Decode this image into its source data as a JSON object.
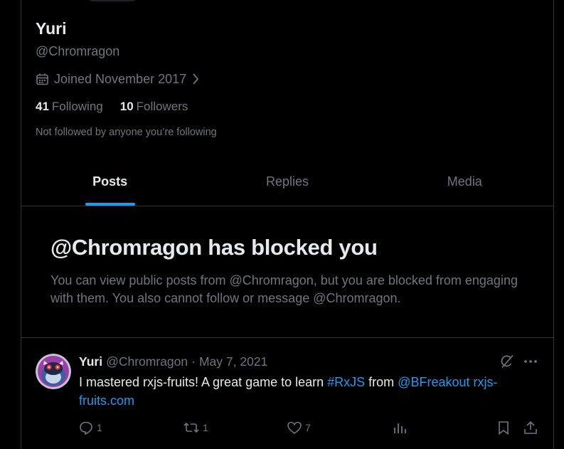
{
  "profile": {
    "name": "Yuri",
    "handle": "@Chromragon",
    "joined": "Joined November 2017",
    "following_count": "41",
    "following_label": "Following",
    "followers_count": "10",
    "followers_label": "Followers",
    "not_followed": "Not followed by anyone you’re following"
  },
  "tabs": [
    {
      "label": "Posts",
      "active": true
    },
    {
      "label": "Replies",
      "active": false
    },
    {
      "label": "Media",
      "active": false
    }
  ],
  "blocked": {
    "title": "@Chromragon has blocked you",
    "description": "You can view public posts from @Chromragon, but you are blocked from engaging with them. You also cannot follow or message @Chromragon."
  },
  "tweet": {
    "name": "Yuri",
    "handle": "@Chromragon",
    "separator": "·",
    "date": "May 7, 2021",
    "text_1": "I mastered rxjs-fruits! A great game to learn ",
    "hashtag": "#RxJS",
    "text_2": " from ",
    "mention": "@BFreakout",
    "link": "rxjs-fruits.com",
    "replies": "1",
    "reposts": "1",
    "likes": "7",
    "icons": [
      "reply-icon",
      "repost-icon",
      "like-icon",
      "views-icon",
      "bookmark-icon",
      "share-icon",
      "grok-icon",
      "more-icon",
      "calendar-icon",
      "chevron-right-icon"
    ]
  },
  "colors": {
    "background": "#000000",
    "text": "#e7e9ea",
    "muted": "#71767b",
    "accent": "#1d9bf0",
    "border": "#2f3336"
  }
}
